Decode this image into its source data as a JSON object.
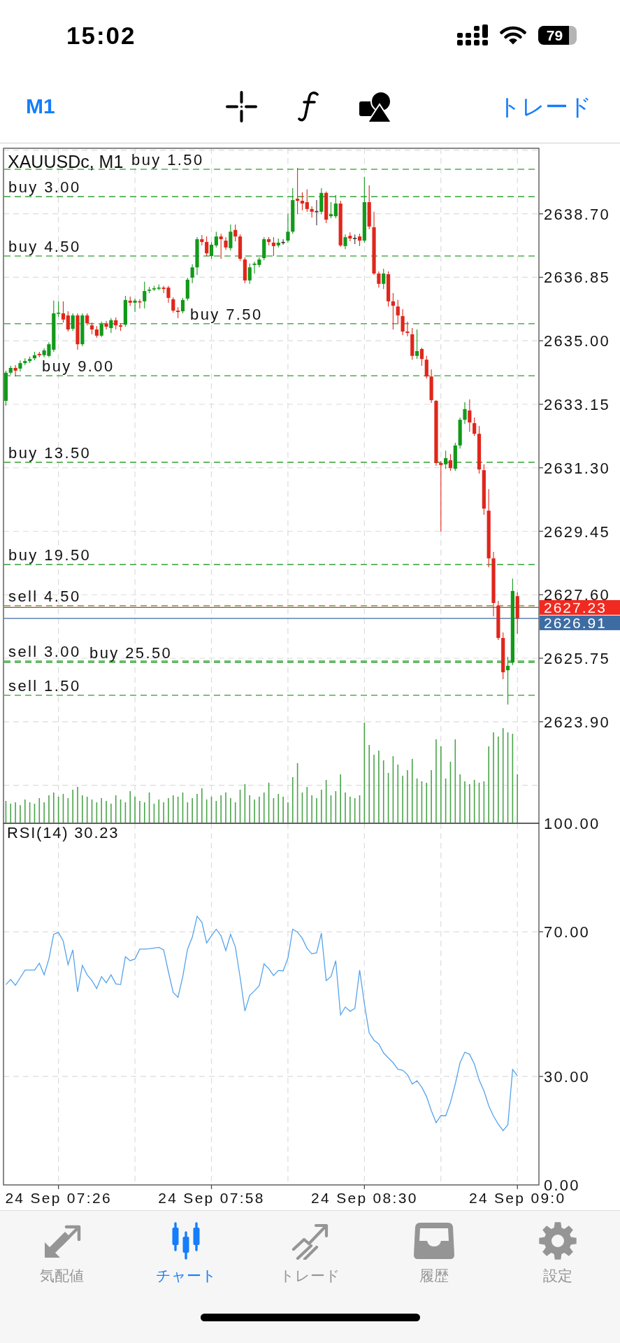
{
  "status_bar": {
    "time": "15:02",
    "battery": "79"
  },
  "toolbar": {
    "timeframe": "M1",
    "trade_button": "トレード"
  },
  "chart": {
    "price_chart": {
      "chart_data": {
        "type": "candlestick",
        "title": "XAUUSDc, M1",
        "categories": [
          null,
          null,
          null,
          null,
          null,
          null,
          null,
          null,
          null,
          null,
          null,
          null,
          null,
          null,
          null,
          null,
          null,
          null,
          null,
          null,
          null,
          null,
          null,
          null,
          null,
          null,
          null,
          null,
          null,
          null,
          null,
          null,
          null,
          null,
          null,
          null,
          null,
          null,
          null,
          null,
          null,
          null,
          null,
          null,
          null,
          null,
          null,
          null,
          null,
          null,
          null,
          null,
          null,
          null,
          null,
          null,
          null,
          null,
          null,
          null,
          null,
          null,
          null,
          null,
          null,
          null,
          null,
          null,
          null,
          null,
          null,
          null,
          null,
          null,
          null,
          null,
          null,
          null,
          null,
          null,
          null,
          null,
          null,
          null,
          null,
          null,
          null,
          null,
          null,
          null,
          null,
          null,
          null,
          null,
          null,
          null,
          null,
          null,
          null,
          null,
          null,
          null,
          null,
          null,
          null,
          null,
          null,
          null,
          null,
          null,
          null,
          null
        ],
        "ohlc": [
          [
            2633.25,
            2634.13,
            2633.11,
            2634.07
          ],
          [
            2634.07,
            2634.27,
            2634.01,
            2634.21
          ],
          [
            2634.21,
            2634.29,
            2633.96,
            2634.13
          ],
          [
            2634.19,
            2634.43,
            2634.11,
            2634.35
          ],
          [
            2634.35,
            2634.49,
            2634.29,
            2634.41
          ],
          [
            2634.41,
            2634.54,
            2634.35,
            2634.47
          ],
          [
            2634.49,
            2634.68,
            2634.43,
            2634.58
          ],
          [
            2634.62,
            2634.68,
            2634.52,
            2634.58
          ],
          [
            2634.58,
            2634.78,
            2634.52,
            2634.72
          ],
          [
            2634.56,
            2634.96,
            2634.52,
            2634.9
          ],
          [
            2634.74,
            2636.17,
            2634.68,
            2635.8
          ],
          [
            2635.8,
            2636.15,
            2635.7,
            2635.82
          ],
          [
            2635.8,
            2636.15,
            2635.53,
            2635.62
          ],
          [
            2635.74,
            2635.86,
            2635.27,
            2635.33
          ],
          [
            2635.35,
            2635.8,
            2635.29,
            2635.74
          ],
          [
            2635.74,
            2635.8,
            2634.74,
            2634.9
          ],
          [
            2634.9,
            2635.8,
            2634.84,
            2635.74
          ],
          [
            2635.74,
            2635.8,
            2635.45,
            2635.51
          ],
          [
            2635.45,
            2635.53,
            2635.19,
            2635.33
          ],
          [
            2635.33,
            2635.43,
            2635.09,
            2635.15
          ],
          [
            2635.15,
            2635.56,
            2635.11,
            2635.49
          ],
          [
            2635.51,
            2635.58,
            2635.33,
            2635.41
          ],
          [
            2635.37,
            2635.66,
            2635.23,
            2635.6
          ],
          [
            2635.6,
            2635.68,
            2635.33,
            2635.45
          ],
          [
            2635.45,
            2635.51,
            2635.29,
            2635.41
          ],
          [
            2635.47,
            2636.31,
            2635.41,
            2636.19
          ],
          [
            2636.17,
            2636.29,
            2636.02,
            2636.11
          ],
          [
            2636.11,
            2636.23,
            2635.84,
            2636.17
          ],
          [
            2636.15,
            2636.21,
            2635.94,
            2636.13
          ],
          [
            2636.15,
            2636.72,
            2635.94,
            2636.45
          ],
          [
            2636.47,
            2636.57,
            2636.39,
            2636.49
          ],
          [
            2636.51,
            2636.6,
            2636.45,
            2636.53
          ],
          [
            2636.53,
            2636.64,
            2636.47,
            2636.55
          ],
          [
            2636.55,
            2636.6,
            2636.39,
            2636.51
          ],
          [
            2636.55,
            2636.6,
            2636.11,
            2636.25
          ],
          [
            2636.21,
            2636.27,
            2635.82,
            2635.88
          ],
          [
            2635.88,
            2635.98,
            2635.66,
            2635.84
          ],
          [
            2635.86,
            2636.25,
            2635.8,
            2636.19
          ],
          [
            2636.23,
            2636.84,
            2636.17,
            2636.78
          ],
          [
            2636.84,
            2637.23,
            2636.68,
            2637.14
          ],
          [
            2637.14,
            2638.02,
            2636.92,
            2637.96
          ],
          [
            2637.96,
            2638.08,
            2637.78,
            2637.88
          ],
          [
            2637.88,
            2638.04,
            2637.47,
            2637.55
          ],
          [
            2637.47,
            2637.88,
            2637.39,
            2637.8
          ],
          [
            2637.78,
            2638.18,
            2637.72,
            2638.04
          ],
          [
            2638.04,
            2638.12,
            2637.39,
            2637.96
          ],
          [
            2637.92,
            2638.02,
            2637.65,
            2637.72
          ],
          [
            2637.7,
            2638.39,
            2637.63,
            2638.18
          ],
          [
            2638.23,
            2638.39,
            2637.9,
            2638.04
          ],
          [
            2638.04,
            2638.1,
            2637.33,
            2637.39
          ],
          [
            2637.37,
            2637.43,
            2636.68,
            2636.76
          ],
          [
            2636.76,
            2637.25,
            2636.66,
            2637.14
          ],
          [
            2637.21,
            2637.31,
            2636.96,
            2637.25
          ],
          [
            2637.21,
            2637.43,
            2637.14,
            2637.37
          ],
          [
            2637.41,
            2638.02,
            2637.35,
            2637.96
          ],
          [
            2637.96,
            2638.02,
            2637.78,
            2637.88
          ],
          [
            2637.86,
            2638.02,
            2637.47,
            2637.76
          ],
          [
            2637.78,
            2637.98,
            2637.72,
            2637.86
          ],
          [
            2637.88,
            2637.96,
            2637.8,
            2637.88
          ],
          [
            2637.92,
            2638.71,
            2637.86,
            2638.18
          ],
          [
            2638.18,
            2639.45,
            2638.12,
            2639.1
          ],
          [
            2639.14,
            2640.04,
            2638.69,
            2639.08
          ],
          [
            2639.08,
            2639.33,
            2638.8,
            2639.0
          ],
          [
            2639.04,
            2639.41,
            2638.76,
            2638.84
          ],
          [
            2638.84,
            2638.92,
            2638.59,
            2638.76
          ],
          [
            2638.78,
            2639.1,
            2638.37,
            2638.78
          ],
          [
            2638.76,
            2639.45,
            2638.69,
            2639.31
          ],
          [
            2639.31,
            2639.35,
            2638.43,
            2638.53
          ],
          [
            2638.63,
            2639.04,
            2638.57,
            2638.69
          ],
          [
            2638.63,
            2639.25,
            2638.57,
            2639.0
          ],
          [
            2639.0,
            2639.08,
            2637.74,
            2637.78
          ],
          [
            2637.76,
            2638.1,
            2637.67,
            2638.02
          ],
          [
            2638.06,
            2638.16,
            2637.9,
            2637.98
          ],
          [
            2638.0,
            2638.1,
            2637.82,
            2638.0
          ],
          [
            2638.04,
            2638.12,
            2637.76,
            2637.92
          ],
          [
            2637.92,
            2639.78,
            2637.86,
            2639.04
          ],
          [
            2639.04,
            2639.53,
            2638.25,
            2638.33
          ],
          [
            2638.31,
            2638.76,
            2636.92,
            2636.96
          ],
          [
            2636.96,
            2637.02,
            2636.55,
            2636.66
          ],
          [
            2636.66,
            2637.1,
            2636.51,
            2636.96
          ],
          [
            2636.94,
            2637.02,
            2636.0,
            2636.15
          ],
          [
            2636.15,
            2636.39,
            2635.33,
            2636.02
          ],
          [
            2636.0,
            2636.19,
            2635.51,
            2635.74
          ],
          [
            2635.72,
            2635.92,
            2635.17,
            2635.27
          ],
          [
            2635.27,
            2635.56,
            2635.13,
            2635.23
          ],
          [
            2635.19,
            2635.37,
            2634.45,
            2634.56
          ],
          [
            2634.56,
            2635.33,
            2634.47,
            2634.7
          ],
          [
            2634.76,
            2634.8,
            2634.27,
            2634.47
          ],
          [
            2634.45,
            2634.56,
            2633.9,
            2633.96
          ],
          [
            2633.96,
            2634.17,
            2633.19,
            2633.27
          ],
          [
            2633.25,
            2633.27,
            2631.36,
            2631.44
          ],
          [
            2631.44,
            2631.5,
            2629.44,
            2631.38
          ],
          [
            2631.4,
            2631.8,
            2631.27,
            2631.58
          ],
          [
            2631.52,
            2631.7,
            2631.21,
            2631.29
          ],
          [
            2631.27,
            2632.03,
            2631.21,
            2631.95
          ],
          [
            2631.95,
            2632.76,
            2631.86,
            2632.7
          ],
          [
            2632.7,
            2633.21,
            2632.58,
            2633.01
          ],
          [
            2632.97,
            2633.29,
            2632.35,
            2632.62
          ],
          [
            2632.6,
            2632.76,
            2632.23,
            2632.29
          ],
          [
            2632.29,
            2632.52,
            2631.13,
            2631.25
          ],
          [
            2631.23,
            2631.4,
            2629.93,
            2630.11
          ],
          [
            2630.05,
            2630.68,
            2628.4,
            2628.66
          ],
          [
            2628.66,
            2628.85,
            2626.97,
            2627.36
          ],
          [
            2627.28,
            2627.42,
            2626.28,
            2626.34
          ],
          [
            2626.34,
            2626.5,
            2625.14,
            2625.34
          ],
          [
            2625.4,
            2625.79,
            2624.4,
            2625.53
          ],
          [
            2625.63,
            2628.07,
            2625.55,
            2627.71
          ],
          [
            2627.56,
            2627.67,
            2626.46,
            2626.91
          ],
          null,
          null,
          null,
          null
        ],
        "ylim": [
          2620.94,
          2640.61
        ],
        "grid": true,
        "yticks": [
          {
            "value": 2638.7,
            "label": "2638.70"
          },
          {
            "value": 2636.85,
            "label": "2636.85"
          },
          {
            "value": 2635,
            "label": "2635.00"
          },
          {
            "value": 2633.15,
            "label": "2633.15"
          },
          {
            "value": 2631.3,
            "label": "2631.30"
          },
          {
            "value": 2629.45,
            "label": "2629.45"
          },
          {
            "value": 2627.6,
            "label": "2627.60"
          },
          {
            "value": 2627.23,
            "label": "2627.23"
          },
          {
            "value": 2626.91,
            "label": "2626.91"
          },
          {
            "value": 2625.75,
            "label": "2625.75"
          },
          {
            "value": 2623.9,
            "label": "2623.90"
          }
        ],
        "ref_lines": [
          {
            "axis": "y",
            "value": 2640.0,
            "label": "buy 1.50",
            "color": "#4fae4f"
          },
          {
            "axis": "y",
            "value": 2639.2,
            "label": "buy 3.00",
            "color": "#4fae4f"
          },
          {
            "axis": "y",
            "value": 2637.47,
            "label": "buy 4.50",
            "color": "#4fae4f"
          },
          {
            "axis": "y",
            "value": 2635.5,
            "label": "buy 7.50",
            "color": "#4fae4f"
          },
          {
            "axis": "y",
            "value": 2633.98,
            "label": "buy 9.00",
            "color": "#4fae4f"
          },
          {
            "axis": "y",
            "value": 2631.46,
            "label": "buy 13.50",
            "color": "#4fae4f"
          },
          {
            "axis": "y",
            "value": 2628.48,
            "label": "buy 19.50",
            "color": "#4fae4f"
          },
          {
            "axis": "y",
            "value": 2627.28,
            "label": "sell 4.50",
            "color": "#4fae4f"
          },
          {
            "axis": "y",
            "value": 2625.67,
            "label": "sell 3.00",
            "color": "#4fae4f"
          },
          {
            "axis": "y",
            "value": 2625.63,
            "label": "buy 25.50",
            "color": "#4fae4f"
          },
          {
            "axis": "y",
            "value": 2624.67,
            "label": "sell 1.50",
            "color": "#4fae4f"
          },
          {
            "axis": "y",
            "value": 2627.23,
            "color": "#f02a20"
          },
          {
            "axis": "y",
            "value": 2626.91,
            "color": "#3d6ca3"
          }
        ]
      }
    },
    "indicator": {
      "chart_data": {
        "type": "line",
        "title": "RSI(14) 30.23",
        "categories": [
          null,
          null,
          null,
          null,
          null,
          null,
          null,
          null,
          null,
          null,
          null,
          "24 Sep 07:26",
          null,
          null,
          null,
          null,
          null,
          null,
          null,
          null,
          null,
          null,
          null,
          null,
          null,
          null,
          null,
          null,
          null,
          null,
          null,
          null,
          null,
          null,
          null,
          null,
          null,
          null,
          null,
          null,
          null,
          null,
          null,
          "24 Sep 07:58",
          null,
          null,
          null,
          null,
          null,
          null,
          null,
          null,
          null,
          null,
          null,
          null,
          null,
          null,
          null,
          null,
          null,
          null,
          null,
          null,
          null,
          null,
          null,
          null,
          null,
          null,
          null,
          null,
          null,
          null,
          null,
          "24 Sep 08:30",
          null,
          null,
          null,
          null,
          null,
          null,
          null,
          null,
          null,
          null,
          null,
          null,
          null,
          null,
          null,
          null,
          null,
          null,
          null,
          null,
          null,
          null,
          null,
          null,
          null,
          null,
          null,
          null,
          null,
          null,
          null,
          "24 Sep 09:0",
          null,
          null,
          null,
          null
        ],
        "series": [
          {
            "color": "#55a3ea",
            "values": [
              55.4,
              56.8,
              55.2,
              57.3,
              59.4,
              59.4,
              59.4,
              61.3,
              58.1,
              62.5,
              69.3,
              69.8,
              67.4,
              60.9,
              65.0,
              53.4,
              60.7,
              58.1,
              56.5,
              54.3,
              57.6,
              55.9,
              58.1,
              55.6,
              55.4,
              63.1,
              62.0,
              62.5,
              65.2,
              65.2,
              65.3,
              65.5,
              65.7,
              65.0,
              58.9,
              53.2,
              51.9,
              57.6,
              65.2,
              68.5,
              74.3,
              72.6,
              66.9,
              68.9,
              70.7,
              68.9,
              64.8,
              69.3,
              65.8,
              57.4,
              48.1,
              52.4,
              53.7,
              55.1,
              61.1,
              59.8,
              57.9,
              59.3,
              59.2,
              62.7,
              70.7,
              69.9,
              68.2,
              65.4,
              63.9,
              64.2,
              69.6,
              56.5,
              57.6,
              62.0,
              47.0,
              49.2,
              48.0,
              48.8,
              59.4,
              50.0,
              42.0,
              40.0,
              39.0,
              36.5,
              35.1,
              33.8,
              32.0,
              31.7,
              30.5,
              27.9,
              28.8,
              27.0,
              24.4,
              20.5,
              17.2,
              19.2,
              19.1,
              22.8,
              27.9,
              33.8,
              36.7,
              36.1,
              33.4,
              29.0,
              26.0,
              21.9,
              19.0,
              16.8,
              15.0,
              16.6,
              31.9,
              30.2,
              null,
              null,
              null,
              null
            ]
          }
        ],
        "ylim": [
          0,
          100
        ],
        "grid": true,
        "yticks": [
          {
            "value": 100,
            "label": "100.00"
          },
          {
            "value": 70,
            "label": "70.00"
          },
          {
            "value": 30,
            "label": "30.00"
          },
          {
            "value": 0,
            "label": "0.00"
          }
        ]
      }
    }
  },
  "tabs": [
    {
      "label": "気配値",
      "selected": false
    },
    {
      "label": "チャート",
      "selected": true
    },
    {
      "label": "トレード",
      "selected": false
    },
    {
      "label": "履歴",
      "selected": false
    },
    {
      "label": "設定",
      "selected": false
    }
  ]
}
